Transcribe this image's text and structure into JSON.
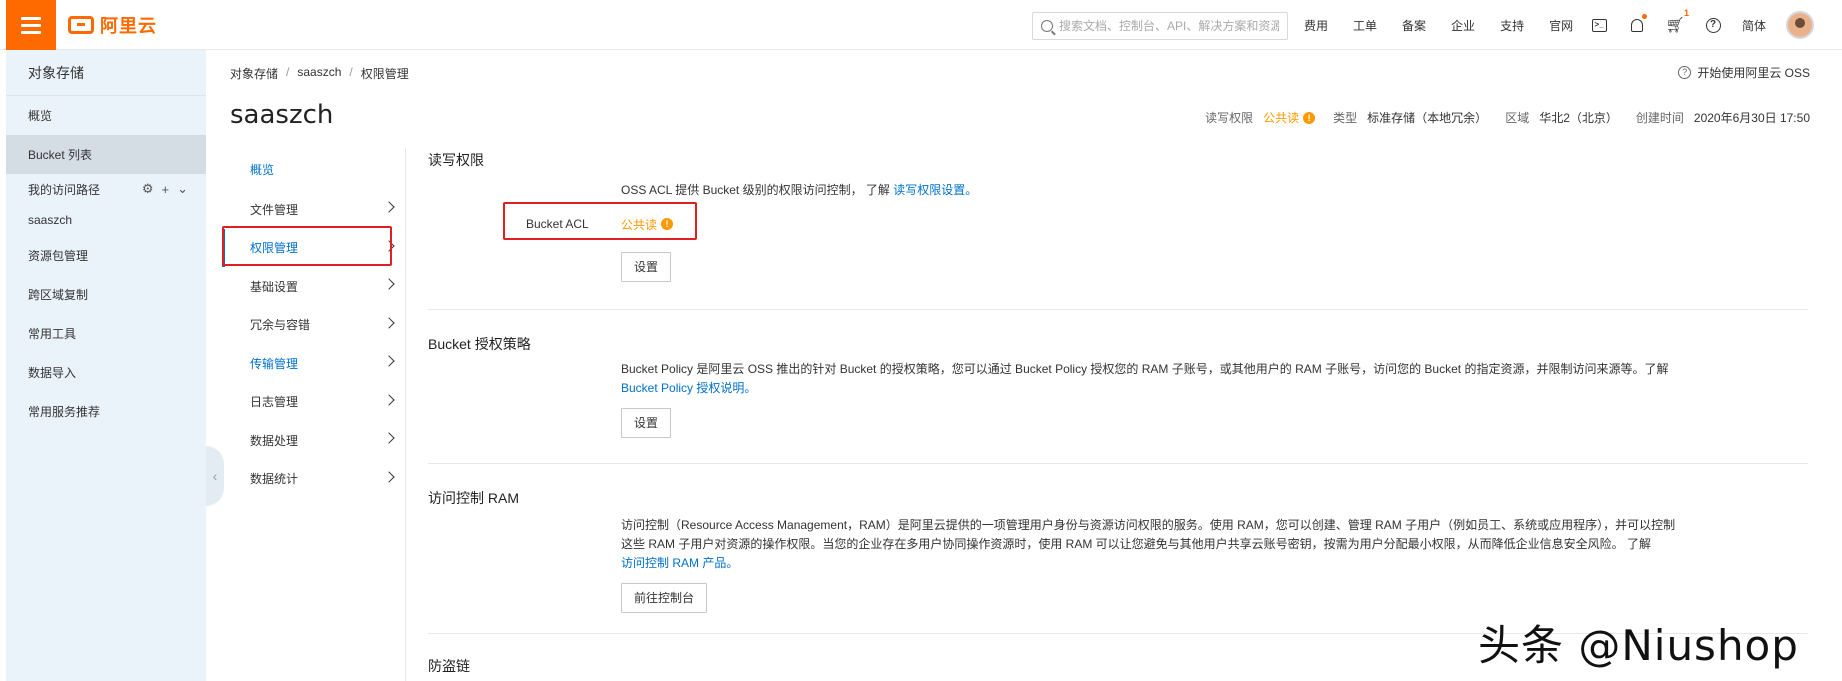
{
  "topbar": {
    "logo_text": "阿里云",
    "search_placeholder": "搜索文档、控制台、API、解决方案和资源",
    "links": [
      "费用",
      "工单",
      "备案",
      "企业",
      "支持",
      "官网"
    ],
    "cart_badge": "1",
    "lang": "简体",
    "accent_color": "#ff6a00"
  },
  "sidebar": {
    "title": "对象存储",
    "items": [
      "概览",
      "Bucket 列表"
    ],
    "path_label": "我的访问路径",
    "path_item": "saaszch",
    "items2": [
      "资源包管理",
      "跨区域复制",
      "常用工具",
      "数据导入",
      "常用服务推荐"
    ]
  },
  "breadcrumb": [
    "对象存储",
    "saaszch",
    "权限管理"
  ],
  "help_link": "开始使用阿里云 OSS",
  "page_title": "saaszch",
  "meta": {
    "acl_label": "读写权限",
    "acl_value": "公共读",
    "type_label": "类型",
    "type_value": "标准存储（本地冗余）",
    "region_label": "区域",
    "region_value": "华北2（北京）",
    "created_label": "创建时间",
    "created_value": "2020年6月30日 17:50"
  },
  "subnav": [
    "概览",
    "文件管理",
    "权限管理",
    "基础设置",
    "冗余与容错",
    "传输管理",
    "日志管理",
    "数据处理",
    "数据统计"
  ],
  "sections": {
    "rw": {
      "title": "读写权限",
      "desc": "OSS ACL 提供 Bucket 级别的权限访问控制， 了解 ",
      "link": "读写权限设置。",
      "acl_label": "Bucket ACL",
      "acl_value": "公共读",
      "button": "设置"
    },
    "policy": {
      "title": "Bucket 授权策略",
      "desc": "Bucket Policy 是阿里云 OSS 推出的针对 Bucket 的授权策略，您可以通过 Bucket Policy 授权您的 RAM 子账号，或其他用户的 RAM 子账号，访问您的 Bucket 的指定资源，并限制访问来源等。了解",
      "link": "Bucket Policy 授权说明。",
      "button": "设置"
    },
    "ram": {
      "title": "访问控制 RAM",
      "desc1": "访问控制（Resource Access Management，RAM）是阿里云提供的一项管理用户身份与资源访问权限的服务。使用 RAM，您可以创建、管理 RAM 子用户（例如员工、系统或应用程序），并可以控制",
      "desc2": "这些 RAM 子用户对资源的操作权限。当您的企业存在多用户协同操作资源时，使用 RAM 可以让您避免与其他用户共享云账号密钥，按需为用户分配最小权限，从而降低企业信息安全风险。 了解",
      "link": "访问控制 RAM 产品。",
      "button": "前往控制台"
    },
    "next_title": "防盗链"
  },
  "watermark": "头条 @Niushop"
}
